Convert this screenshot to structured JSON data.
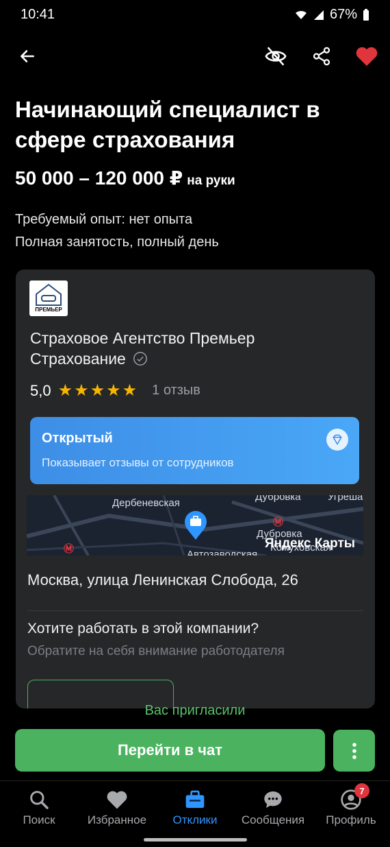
{
  "status_bar": {
    "time": "10:41",
    "battery": "67%"
  },
  "vacancy": {
    "title": "Начинающий специалист в сфере страхования",
    "salary": "50 000 – 120 000 ₽",
    "salary_note": "на руки",
    "experience": "Требуемый опыт: нет опыта",
    "employment": "Полная занятость, полный день"
  },
  "company": {
    "logo_text": "ПРЕМЬЕР",
    "name": "Страховое Агентство Премьер Страхование",
    "rating": "5,0",
    "stars": 5,
    "reviews": "1 отзыв",
    "badge_title": "Открытый",
    "badge_subtitle": "Показывает отзывы от сотрудников"
  },
  "map": {
    "labels": [
      "Дербеневская",
      "Дубровка",
      "Угреша",
      "Дубровка",
      "Кожуховская",
      "Автозаводская"
    ],
    "brand": "Яндекс Карты"
  },
  "address": "Москва, улица Ленинская Слобода, 26",
  "cta_section": {
    "question": "Хотите работать в этой компании?",
    "subtitle": "Обратите на себя внимание работодателя"
  },
  "invite_status": "Вас пригласили",
  "chat_button": "Перейти в чат",
  "bottom_nav": [
    {
      "label": "Поиск",
      "icon": "search-icon"
    },
    {
      "label": "Избранное",
      "icon": "heart-icon"
    },
    {
      "label": "Отклики",
      "icon": "briefcase-icon"
    },
    {
      "label": "Сообщения",
      "icon": "chat-icon"
    },
    {
      "label": "Профиль",
      "icon": "profile-icon",
      "badge": "7"
    }
  ],
  "colors": {
    "accent_green": "#4bb35f",
    "active_blue": "#2f95ff",
    "favorite_red": "#e0353d",
    "star_yellow": "#f7b500"
  }
}
